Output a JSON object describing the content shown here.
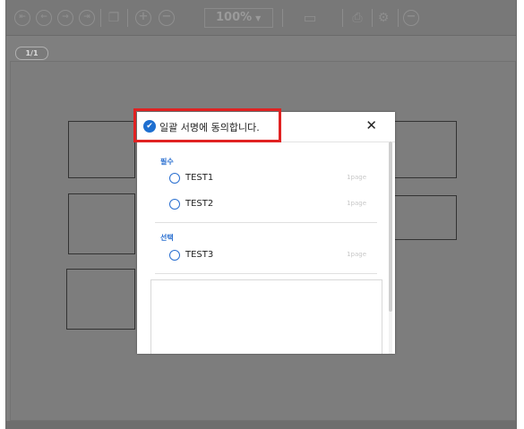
{
  "toolbar": {
    "icons": [
      "first-page-icon",
      "prev-page-icon",
      "next-page-icon",
      "last-page-icon",
      "page-copy-icon",
      "zoom-in-icon",
      "zoom-out-icon",
      "save-icon",
      "print-icon",
      "print-settings-icon",
      "close-doc-icon"
    ],
    "zoom_value": "100%"
  },
  "page_indicator": "1/1",
  "dialog": {
    "select_all_label": "일괄 서명에 동의합니다.",
    "close_glyph": "✕",
    "groups": [
      {
        "title": "필수",
        "items": [
          {
            "name": "TEST1",
            "pages": "1page"
          },
          {
            "name": "TEST2",
            "pages": "1page"
          }
        ]
      },
      {
        "title": "선택",
        "items": [
          {
            "name": "TEST3",
            "pages": "1page"
          }
        ]
      }
    ]
  },
  "colors": {
    "highlight": "#e02222",
    "accent": "#2a6fd0"
  }
}
